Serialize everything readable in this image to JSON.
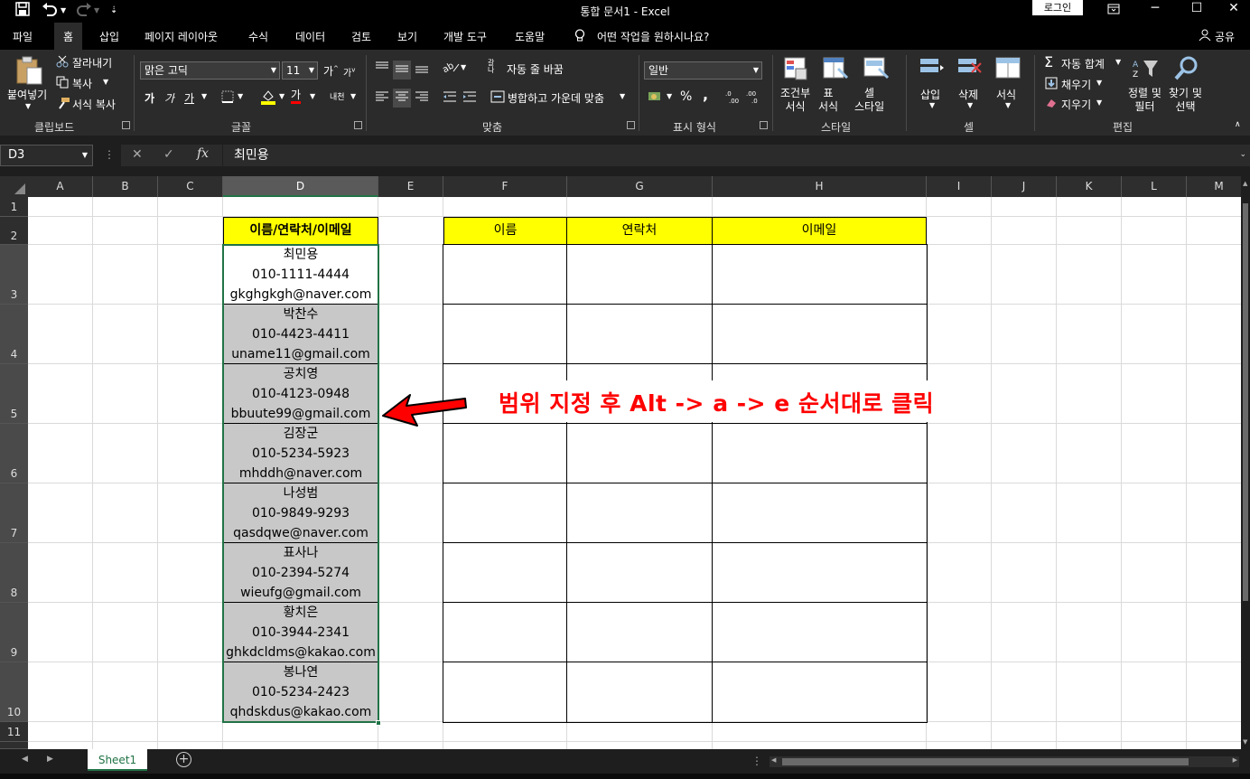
{
  "window": {
    "title": "통합 문서1  -  Excel",
    "login": "로그인"
  },
  "tabs": [
    "파일",
    "홈",
    "삽입",
    "페이지 레이아웃",
    "수식",
    "데이터",
    "검토",
    "보기",
    "개발 도구",
    "도움말"
  ],
  "tell_me": "어떤 작업을 원하시나요?",
  "share": "공유",
  "ribbon": {
    "clipboard": {
      "paste": "붙여넣기",
      "cut": "잘라내기",
      "copy": "복사",
      "format_painter": "서식 복사",
      "group": "클립보드"
    },
    "font": {
      "name": "맑은 고딕",
      "size": "11",
      "group": "글꼴",
      "grow": "가",
      "shrink": "가",
      "bold": "가",
      "italic": "가",
      "underline": "가",
      "color_letter": "가",
      "phonetic": "내천"
    },
    "alignment": {
      "wrap": "자동 줄 바꿈",
      "merge": "병합하고 가운데 맞춤",
      "group": "맞춤"
    },
    "number": {
      "format": "일반",
      "group": "표시 형식",
      "percent": "%",
      "comma": ","
    },
    "styles": {
      "conditional": "조건부\n서식",
      "table": "표\n서식",
      "cell": "셀\n스타일",
      "group": "스타일"
    },
    "cells": {
      "insert": "삽입",
      "delete": "삭제",
      "format": "서식",
      "group": "셀"
    },
    "editing": {
      "autosum": "자동 합계",
      "fill": "채우기",
      "clear": "지우기",
      "sort": "정렬 및\n필터",
      "find": "찾기 및\n선택",
      "group": "편집"
    }
  },
  "formula_bar": {
    "name_box": "D3",
    "content": "최민용"
  },
  "columns": [
    "A",
    "B",
    "C",
    "D",
    "E",
    "F",
    "G",
    "H",
    "I",
    "J",
    "K",
    "L",
    "M"
  ],
  "rows": [
    "1",
    "2",
    "3",
    "4",
    "5",
    "6",
    "7",
    "8",
    "9",
    "10",
    "11"
  ],
  "sheet": {
    "d_header": "이름/연락처/이메일",
    "d_cells": [
      [
        "최민용",
        "010-1111-4444",
        "gkghgkgh@naver.com"
      ],
      [
        "박찬수",
        "010-4423-4411",
        "uname11@gmail.com"
      ],
      [
        "공치영",
        "010-4123-0948",
        "bbuute99@gmail.com"
      ],
      [
        "김장군",
        "010-5234-5923",
        "mhddh@naver.com"
      ],
      [
        "나성범",
        "010-9849-9293",
        "qasdqwe@naver.com"
      ],
      [
        "표사나",
        "010-2394-5274",
        "wieufg@gmail.com"
      ],
      [
        "황치은",
        "010-3944-2341",
        "ghkdcldms@kakao.com"
      ],
      [
        "봉나연",
        "010-5234-2423",
        "qhdskdus@kakao.com"
      ]
    ],
    "table_headers": [
      "이름",
      "연락처",
      "이메일"
    ]
  },
  "annotation": "범위 지정 후  Alt -> a -> e  순서대로 클릭",
  "sheet_tabs": [
    "Sheet1"
  ],
  "colors": {
    "accent": "#217346",
    "header_fill": "#ffff00",
    "selection_fill": "#c8c8c8",
    "annotation": "#ff0000"
  }
}
